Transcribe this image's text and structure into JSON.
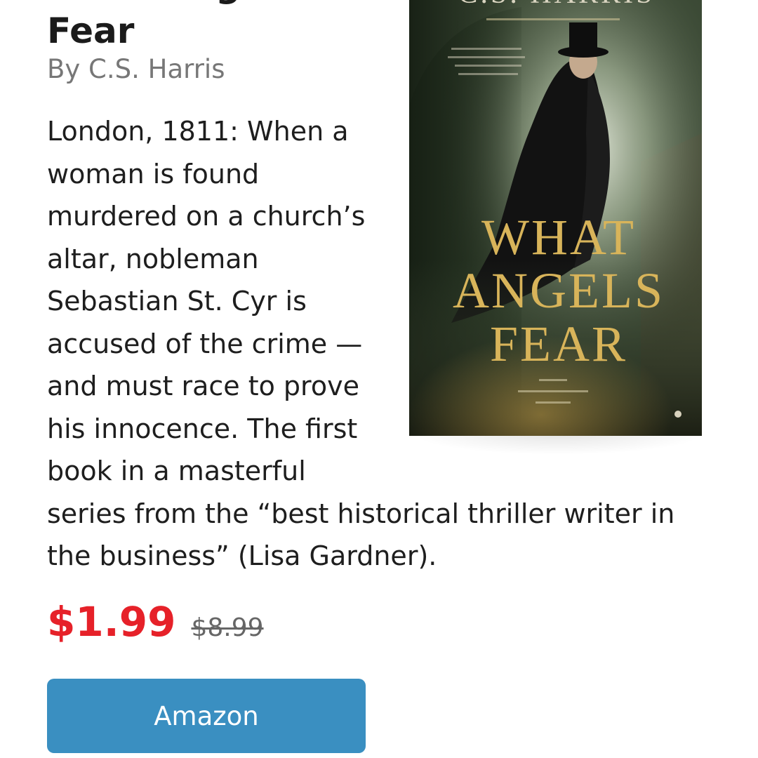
{
  "book": {
    "title_lines": [
      "What Angels",
      "Fear"
    ],
    "author": "By C.S. Harris",
    "description_lines": [
      "London, 1811: When a",
      "woman is found",
      "murdered on a church’s",
      "altar, nobleman",
      "Sebastian St. Cyr is",
      "accused of the crime —",
      "and must race to prove",
      "his innocence. The first",
      "book in a masterful",
      "series from the “best historical thriller writer in",
      "the business” (Lisa Gardner)."
    ],
    "sale_price": "$1.99",
    "list_price": "$8.99",
    "buy_button_label": "Amazon"
  },
  "cover": {
    "author_banner": "C.S. HARRIS",
    "title_lines": [
      "WHAT",
      "ANGELS",
      "FEAR"
    ],
    "image_description": "Book cover: a cloaked man in a top hat looking over his shoulder in a misty, green-lit London street"
  },
  "colors": {
    "sale_price": "#e62129",
    "button": "#3a8fc1",
    "cover_title": "#d8b45a"
  }
}
